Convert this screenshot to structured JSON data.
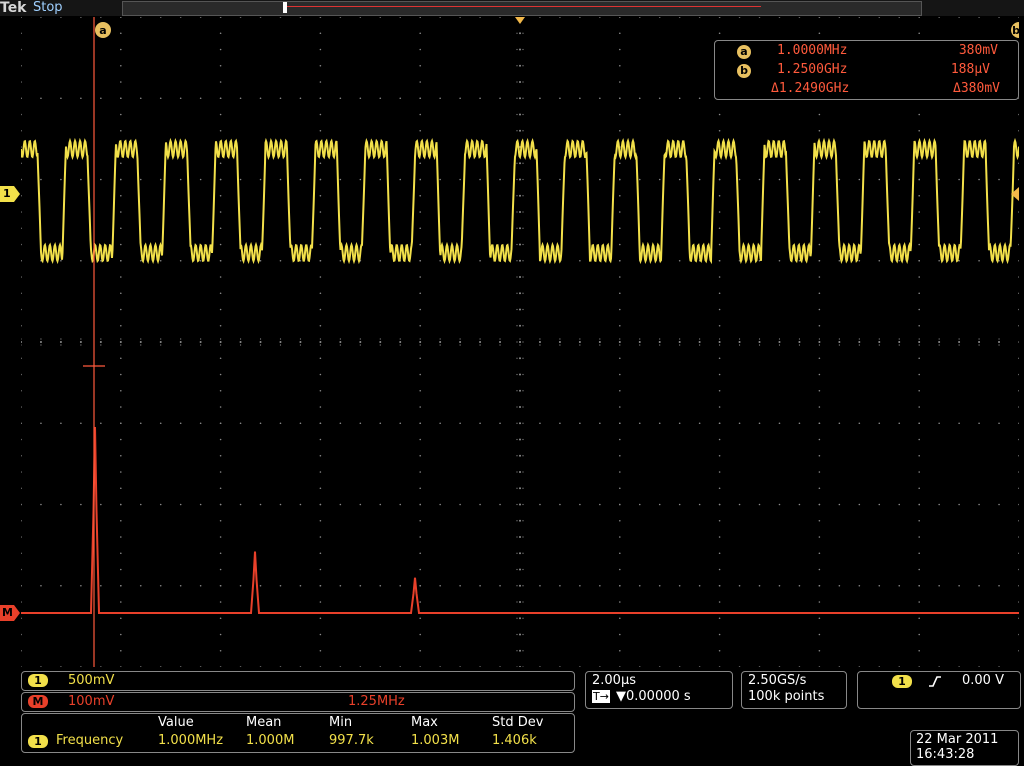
{
  "header": {
    "brand": "Tek",
    "status": "Stop"
  },
  "cursors": {
    "a_label": "a",
    "b_label": "b",
    "a_freq": "1.0000MHz",
    "a_volt": "380mV",
    "b_freq": "1.2500GHz",
    "b_volt": "188µV",
    "delta_freq": "Δ1.2490GHz",
    "delta_volt": "Δ380mV"
  },
  "channels": {
    "ch1_chip": "1",
    "ch1_scale": "500mV",
    "math_chip": "M",
    "math_scale": "100mV",
    "math_center": "1.25MHz",
    "ch1_marker": "1",
    "math_marker": "M"
  },
  "measurement": {
    "headers": [
      "Value",
      "Mean",
      "Min",
      "Max",
      "Std Dev"
    ],
    "source_chip": "1",
    "name": "Frequency",
    "values": [
      "1.000MHz",
      "1.000M",
      "997.7k",
      "1.003M",
      "1.406k"
    ]
  },
  "timebase": {
    "scale": "2.00µs",
    "delay": "▼0.00000 s",
    "delay_icon": "T→"
  },
  "acquisition": {
    "rate": "2.50GS/s",
    "points": "100k points"
  },
  "trigger": {
    "source": "1",
    "slope": "rising",
    "level": "0.00 V"
  },
  "datetime": {
    "date": "22 Mar 2011",
    "time": "16:43:28"
  },
  "colors": {
    "ch1": "#f2e04a",
    "math": "#e8402a",
    "grid": "#8a8a8a",
    "cursor": "#ff5a3c"
  },
  "chart_data": [
    {
      "type": "line",
      "title": "",
      "series": [
        {
          "name": "",
          "shape": "square wave with high-frequency ripple",
          "frequency_MHz": 1.0,
          "amplitude_mV": 380
        }
      ],
      "x_per_div": "2.00µs",
      "y_per_div": "500mV"
    },
    {
      "type": "line",
      "title": "",
      "series": [
        {
          "name": "",
          "peaks_MHz": [
            1.0,
            3.0,
            5.0
          ],
          "relative_heights": [
            1.0,
            0.33,
            0.19
          ]
        }
      ],
      "center": "1.25MHz",
      "y_per_div": "100mV"
    }
  ]
}
